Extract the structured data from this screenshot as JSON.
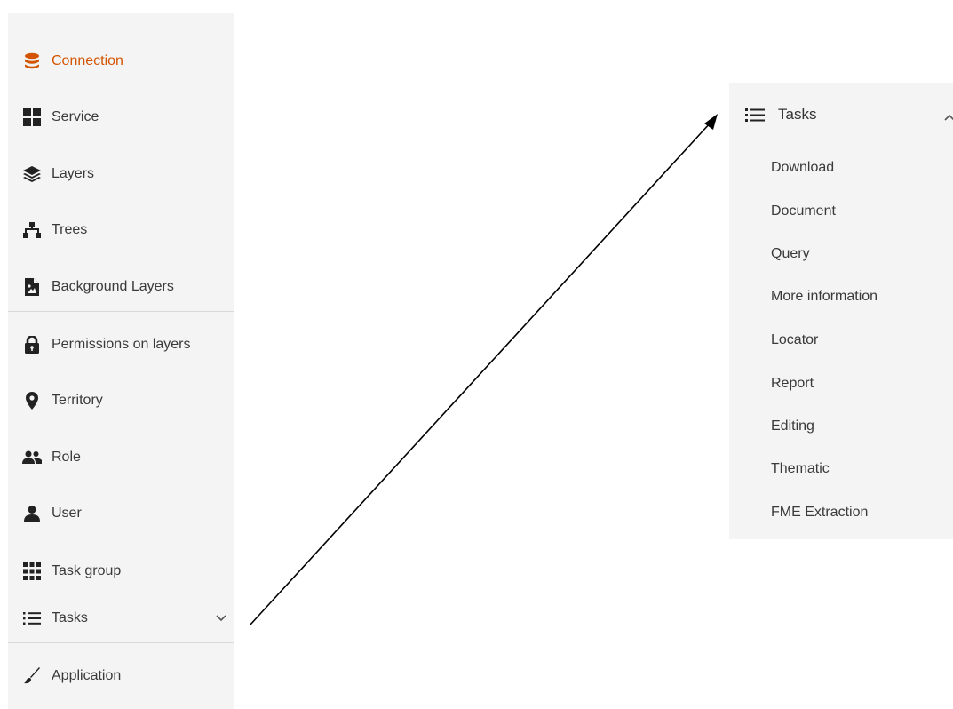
{
  "sidebar": {
    "items": [
      {
        "label": "Connection",
        "icon": "database-icon"
      },
      {
        "label": "Service",
        "icon": "grid-icon"
      },
      {
        "label": "Layers",
        "icon": "layers-icon"
      },
      {
        "label": "Trees",
        "icon": "sitemap-icon"
      },
      {
        "label": "Background Layers",
        "icon": "image-file-icon"
      },
      {
        "label": "Permissions on layers",
        "icon": "lock-icon"
      },
      {
        "label": "Territory",
        "icon": "map-marker-icon"
      },
      {
        "label": "Role",
        "icon": "users-icon"
      },
      {
        "label": "User",
        "icon": "user-icon"
      },
      {
        "label": "Task group",
        "icon": "apps-grid-icon"
      },
      {
        "label": "Tasks",
        "icon": "list-icon"
      },
      {
        "label": "Application",
        "icon": "brush-icon"
      }
    ],
    "active_color": "#d35400"
  },
  "tasks_panel": {
    "title": "Tasks",
    "items": [
      "Download",
      "Document",
      "Query",
      "More information",
      "Locator",
      "Report",
      "Editing",
      "Thematic",
      "FME Extraction"
    ]
  }
}
